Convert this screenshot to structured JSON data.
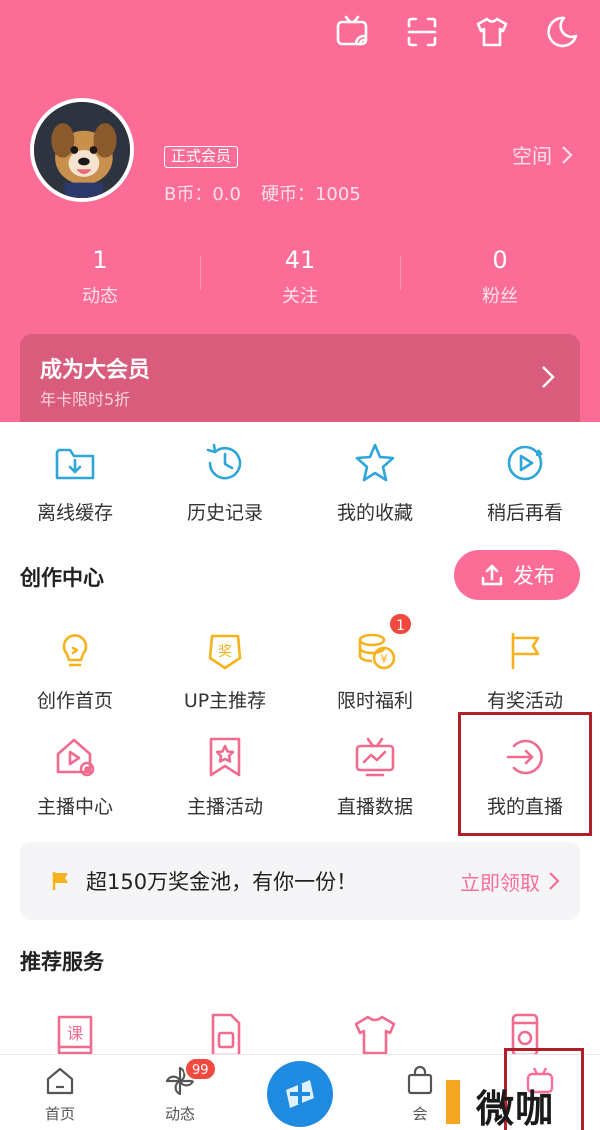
{
  "colors": {
    "accent": "#fb6d96",
    "vip_card": "#d95c7c",
    "badge_red": "#f0493f",
    "highlight": "#b0202a",
    "gold": "#f5b21d",
    "blue": "#1f8be0"
  },
  "top_icons": [
    "tv-cast-icon",
    "scan-icon",
    "tshirt-icon",
    "moon-icon"
  ],
  "profile": {
    "badge": "正式会员",
    "coins": "B币：0.0",
    "hard_coins": "硬币：1005",
    "space_label": "空间"
  },
  "stats": [
    {
      "value": "1",
      "label": "动态"
    },
    {
      "value": "41",
      "label": "关注"
    },
    {
      "value": "0",
      "label": "粉丝"
    }
  ],
  "vip": {
    "title": "成为大会员",
    "subtitle": "年卡限时5折"
  },
  "quick": [
    {
      "label": "离线缓存",
      "icon": "download-folder-icon"
    },
    {
      "label": "历史记录",
      "icon": "history-clock-icon"
    },
    {
      "label": "我的收藏",
      "icon": "star-icon"
    },
    {
      "label": "稍后再看",
      "icon": "play-later-icon"
    }
  ],
  "create_center": {
    "title": "创作中心",
    "publish_label": "发布",
    "row1": [
      {
        "label": "创作首页",
        "icon": "lightbulb-icon"
      },
      {
        "label": "UP主推荐",
        "icon": "award-badge-icon"
      },
      {
        "label": "限时福利",
        "icon": "coins-icon",
        "badge": "1"
      },
      {
        "label": "有奖活动",
        "icon": "flag-icon"
      }
    ],
    "row2": [
      {
        "label": "主播中心",
        "icon": "house-play-icon"
      },
      {
        "label": "主播活动",
        "icon": "bookmark-star-icon"
      },
      {
        "label": "直播数据",
        "icon": "tv-chart-icon"
      },
      {
        "label": "我的直播",
        "icon": "enter-arrow-icon"
      }
    ]
  },
  "banner": {
    "text": "超150万奖金池，有你一份！",
    "link": "立即领取"
  },
  "recommend": {
    "title": "推荐服务",
    "items": [
      "course-book-icon",
      "sim-card-icon",
      "tshirt-icon",
      "phone-cartoon-icon"
    ],
    "item_text": [
      "课"
    ]
  },
  "bottom_nav": [
    {
      "label": "首页",
      "icon": "home-icon"
    },
    {
      "label": "动态",
      "icon": "pinwheel-icon",
      "badge": "99"
    },
    {
      "label": "",
      "icon": "plus-icon"
    },
    {
      "label": "会",
      "icon": "bag-icon"
    },
    {
      "label": "",
      "icon": "tv-face-icon"
    }
  ],
  "watermark": "微咖"
}
